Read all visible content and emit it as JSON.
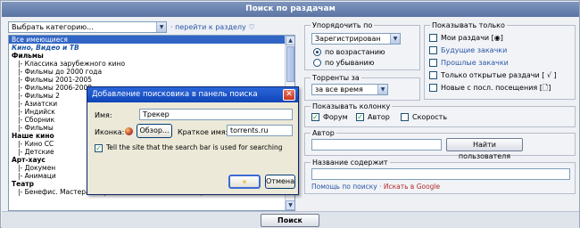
{
  "window": {
    "title": "Поиск по раздачам"
  },
  "category_select": {
    "value": "Выбрать категорию...",
    "goto_link": "перейти к разделу"
  },
  "category_list": [
    {
      "text": "Все имеющиеся",
      "kind": "selected"
    },
    {
      "text": "Кино, Видео и ТВ",
      "kind": "cat"
    },
    {
      "text": "Фильмы",
      "kind": "bold"
    },
    {
      "text": "|- Классика зарубежного кино",
      "kind": "ind"
    },
    {
      "text": "|- Фильмы до 2000 года",
      "kind": "ind"
    },
    {
      "text": "|- Фильмы 2001-2005",
      "kind": "ind"
    },
    {
      "text": "|- Фильмы 2006-2008",
      "kind": "ind"
    },
    {
      "text": "|- Фильмы 2",
      "kind": "ind"
    },
    {
      "text": "|- Азиатски",
      "kind": "ind"
    },
    {
      "text": "|- Индийск",
      "kind": "ind"
    },
    {
      "text": "|- Сборник",
      "kind": "ind"
    },
    {
      "text": "|- Фильмы",
      "kind": "ind"
    },
    {
      "text": "Наше кино",
      "kind": "bold"
    },
    {
      "text": "|- Кино СС",
      "kind": "ind"
    },
    {
      "text": "|- Детские",
      "kind": "ind"
    },
    {
      "text": "Арт-хаус",
      "kind": "bold"
    },
    {
      "text": "|- Докумен",
      "kind": "ind"
    },
    {
      "text": "|- Анимаци",
      "kind": "ind"
    },
    {
      "text": "Театр",
      "kind": "bold"
    },
    {
      "text": "|- Бенефис. Мастера искусств отечественного Театра и Кино.",
      "kind": "ind"
    }
  ],
  "icon_row": [
    "check",
    "check",
    "star",
    "percent",
    "check",
    "cross",
    "target",
    "check",
    "check",
    "question",
    "exclaim",
    "check",
    "sigma",
    "check",
    "copyright",
    "T",
    "check",
    "hash"
  ],
  "sort": {
    "legend": "Упорядочить по",
    "value": "Зарегистрирован",
    "asc": "по возрастанию",
    "desc": "по убыванию"
  },
  "torrents": {
    "legend": "Торренты за",
    "value": "за все время"
  },
  "show_columns": {
    "legend": "Показывать колонку",
    "forum": "Форум",
    "author": "Автор",
    "speed": "Скорость"
  },
  "author": {
    "legend": "Автор",
    "find_button": "Найти пользователя"
  },
  "title_search": {
    "legend": "Название содержит",
    "help_link": "Помощь по поиску",
    "separator": "·",
    "google_link": "Искать в Google"
  },
  "show_only": {
    "legend": "Показывать только",
    "items": [
      {
        "label": "Мои раздачи [◉]",
        "checked": false,
        "link": false
      },
      {
        "label": "Будущие закачки",
        "checked": false,
        "link": true
      },
      {
        "label": "Прошлые закачки",
        "checked": false,
        "link": true
      },
      {
        "label": "Только открытые раздачи [ √ ]",
        "checked": false,
        "link": false
      },
      {
        "label": "Новые с посл. посещения [🗋]",
        "checked": false,
        "link": false
      }
    ]
  },
  "search_button": "Поиск",
  "dialog": {
    "title": "Добавление поисковика в панель поиска",
    "close": "✕",
    "name_label": "Имя:",
    "name_value": "Трекер",
    "icon_label": "Иконка:",
    "browse_button": "Обзор...",
    "short_label": "Краткое имя:",
    "short_value": "torrents.ru",
    "tell_label": "Tell the site that the search bar is used for searching",
    "ok_button": "",
    "cancel_button": "Отмена"
  },
  "colors": {
    "titlebar": "#6a82b0",
    "link": "#2b56a6",
    "dialog_title": "#1a52c4",
    "selected": "#3165c5"
  }
}
